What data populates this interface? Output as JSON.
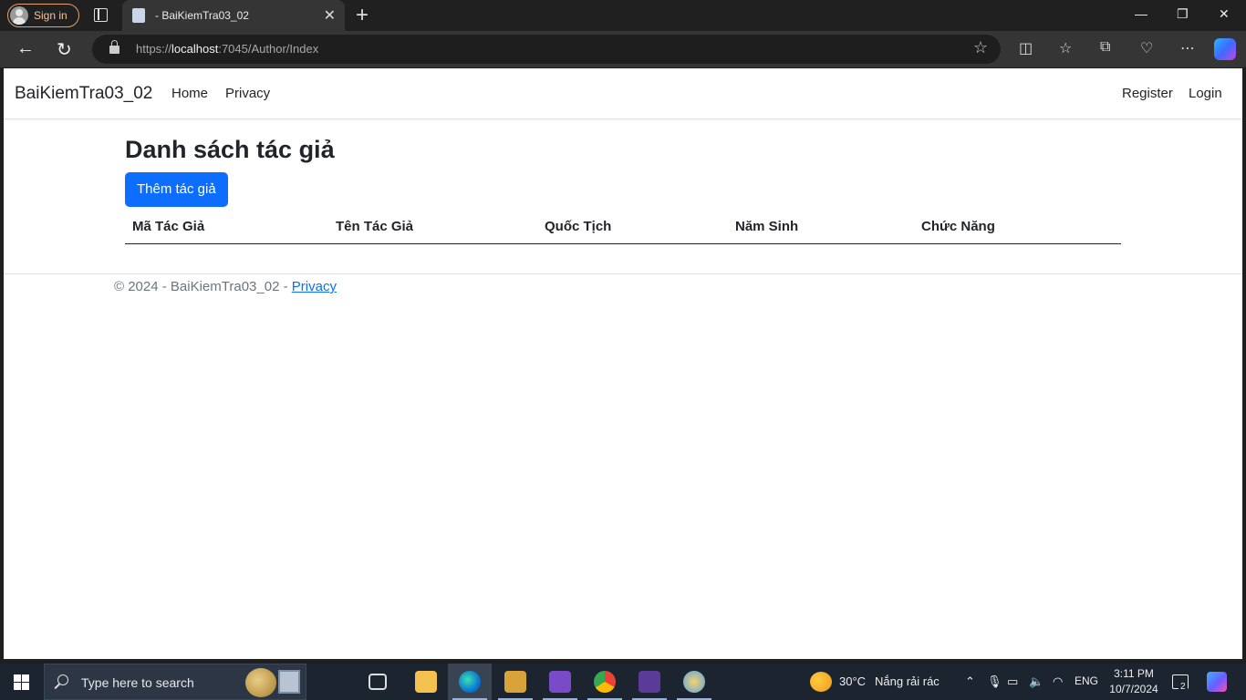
{
  "browser": {
    "signin_label": "Sign in",
    "tab_title": "- BaiKiemTra03_02",
    "url_scheme": "https://",
    "url_host": "localhost",
    "url_rest": ":7045/Author/Index"
  },
  "site": {
    "brand": "BaiKiemTra03_02",
    "nav": {
      "home": "Home",
      "privacy": "Privacy",
      "register": "Register",
      "login": "Login"
    }
  },
  "page": {
    "heading": "Danh sách tác giả",
    "add_button": "Thêm tác giả",
    "table": {
      "columns": [
        "Mã Tác Giả",
        "Tên Tác Giả",
        "Quốc Tịch",
        "Năm Sinh",
        "Chức Năng"
      ],
      "rows": []
    }
  },
  "footer": {
    "text": "© 2024 - BaiKiemTra03_02 - ",
    "privacy_link": "Privacy"
  },
  "taskbar": {
    "search_placeholder": "Type here to search",
    "temperature": "30°C",
    "weather": "Nắng rải rác",
    "language": "ENG",
    "time": "3:11 PM",
    "date": "10/7/2024",
    "notification_count": "2"
  },
  "colors": {
    "accent": "#0d6efd",
    "text": "#212529",
    "muted": "#6c757d"
  }
}
